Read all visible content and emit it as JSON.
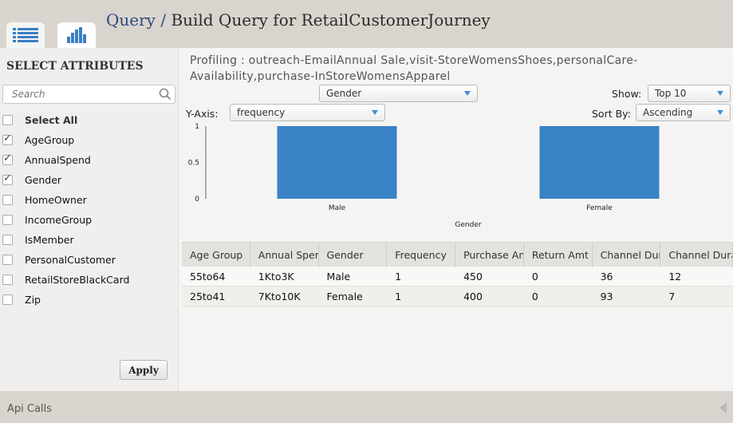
{
  "header": {
    "title_prefix": "Query",
    "title_sep": " / ",
    "title_rest": "Build Query for RetailCustomerJourney"
  },
  "tabs": [
    {
      "icon": "list-icon",
      "active": false
    },
    {
      "icon": "bar-chart-icon",
      "active": true
    }
  ],
  "colors": {
    "accent": "#3a7fc4",
    "bar": "#3a82c6",
    "header_bg": "#d9d4cd"
  },
  "sidebar": {
    "title": "SELECT ATTRIBUTES",
    "search_placeholder": "Search",
    "select_all": "Select All",
    "items": [
      {
        "label": "AgeGroup",
        "checked": true
      },
      {
        "label": "AnnualSpend",
        "checked": true
      },
      {
        "label": "Gender",
        "checked": true
      },
      {
        "label": "HomeOwner",
        "checked": false
      },
      {
        "label": "IncomeGroup",
        "checked": false
      },
      {
        "label": "IsMember",
        "checked": false
      },
      {
        "label": "PersonalCustomer",
        "checked": false
      },
      {
        "label": "RetailStoreBlackCard",
        "checked": false
      },
      {
        "label": "Zip",
        "checked": false
      }
    ],
    "apply_label": "Apply"
  },
  "main": {
    "profiling": "Profiling : outreach-EmailAnnual Sale,visit-StoreWomensShoes,personalCare-Availability,purchase-InStoreWomensApparel",
    "x_select": "Gender",
    "show_label": "Show:",
    "show_value": "Top 10",
    "yaxis_label": "Y-Axis:",
    "yaxis_value": "frequency",
    "sort_label": "Sort By:",
    "sort_value": "Ascending"
  },
  "chart_data": {
    "type": "bar",
    "categories": [
      "Male",
      "Female"
    ],
    "values": [
      1,
      1
    ],
    "xlabel": "Gender",
    "ylabel": "",
    "ylim": [
      0,
      1
    ],
    "yticks": [
      "0",
      "0.5",
      "1"
    ],
    "grid": false
  },
  "table": {
    "columns": [
      "Age Group",
      "Annual Spend",
      "Gender",
      "Frequency",
      "Purchase Amt",
      "Return Amt",
      "Channel Duration",
      "Channel Duration"
    ],
    "rows": [
      [
        "55to64",
        "1Kto3K",
        "Male",
        "1",
        "450",
        "0",
        "36",
        "12"
      ],
      [
        "25to41",
        "7Kto10K",
        "Female",
        "1",
        "400",
        "0",
        "93",
        "7"
      ]
    ]
  },
  "footer": {
    "label": "Api Calls"
  }
}
